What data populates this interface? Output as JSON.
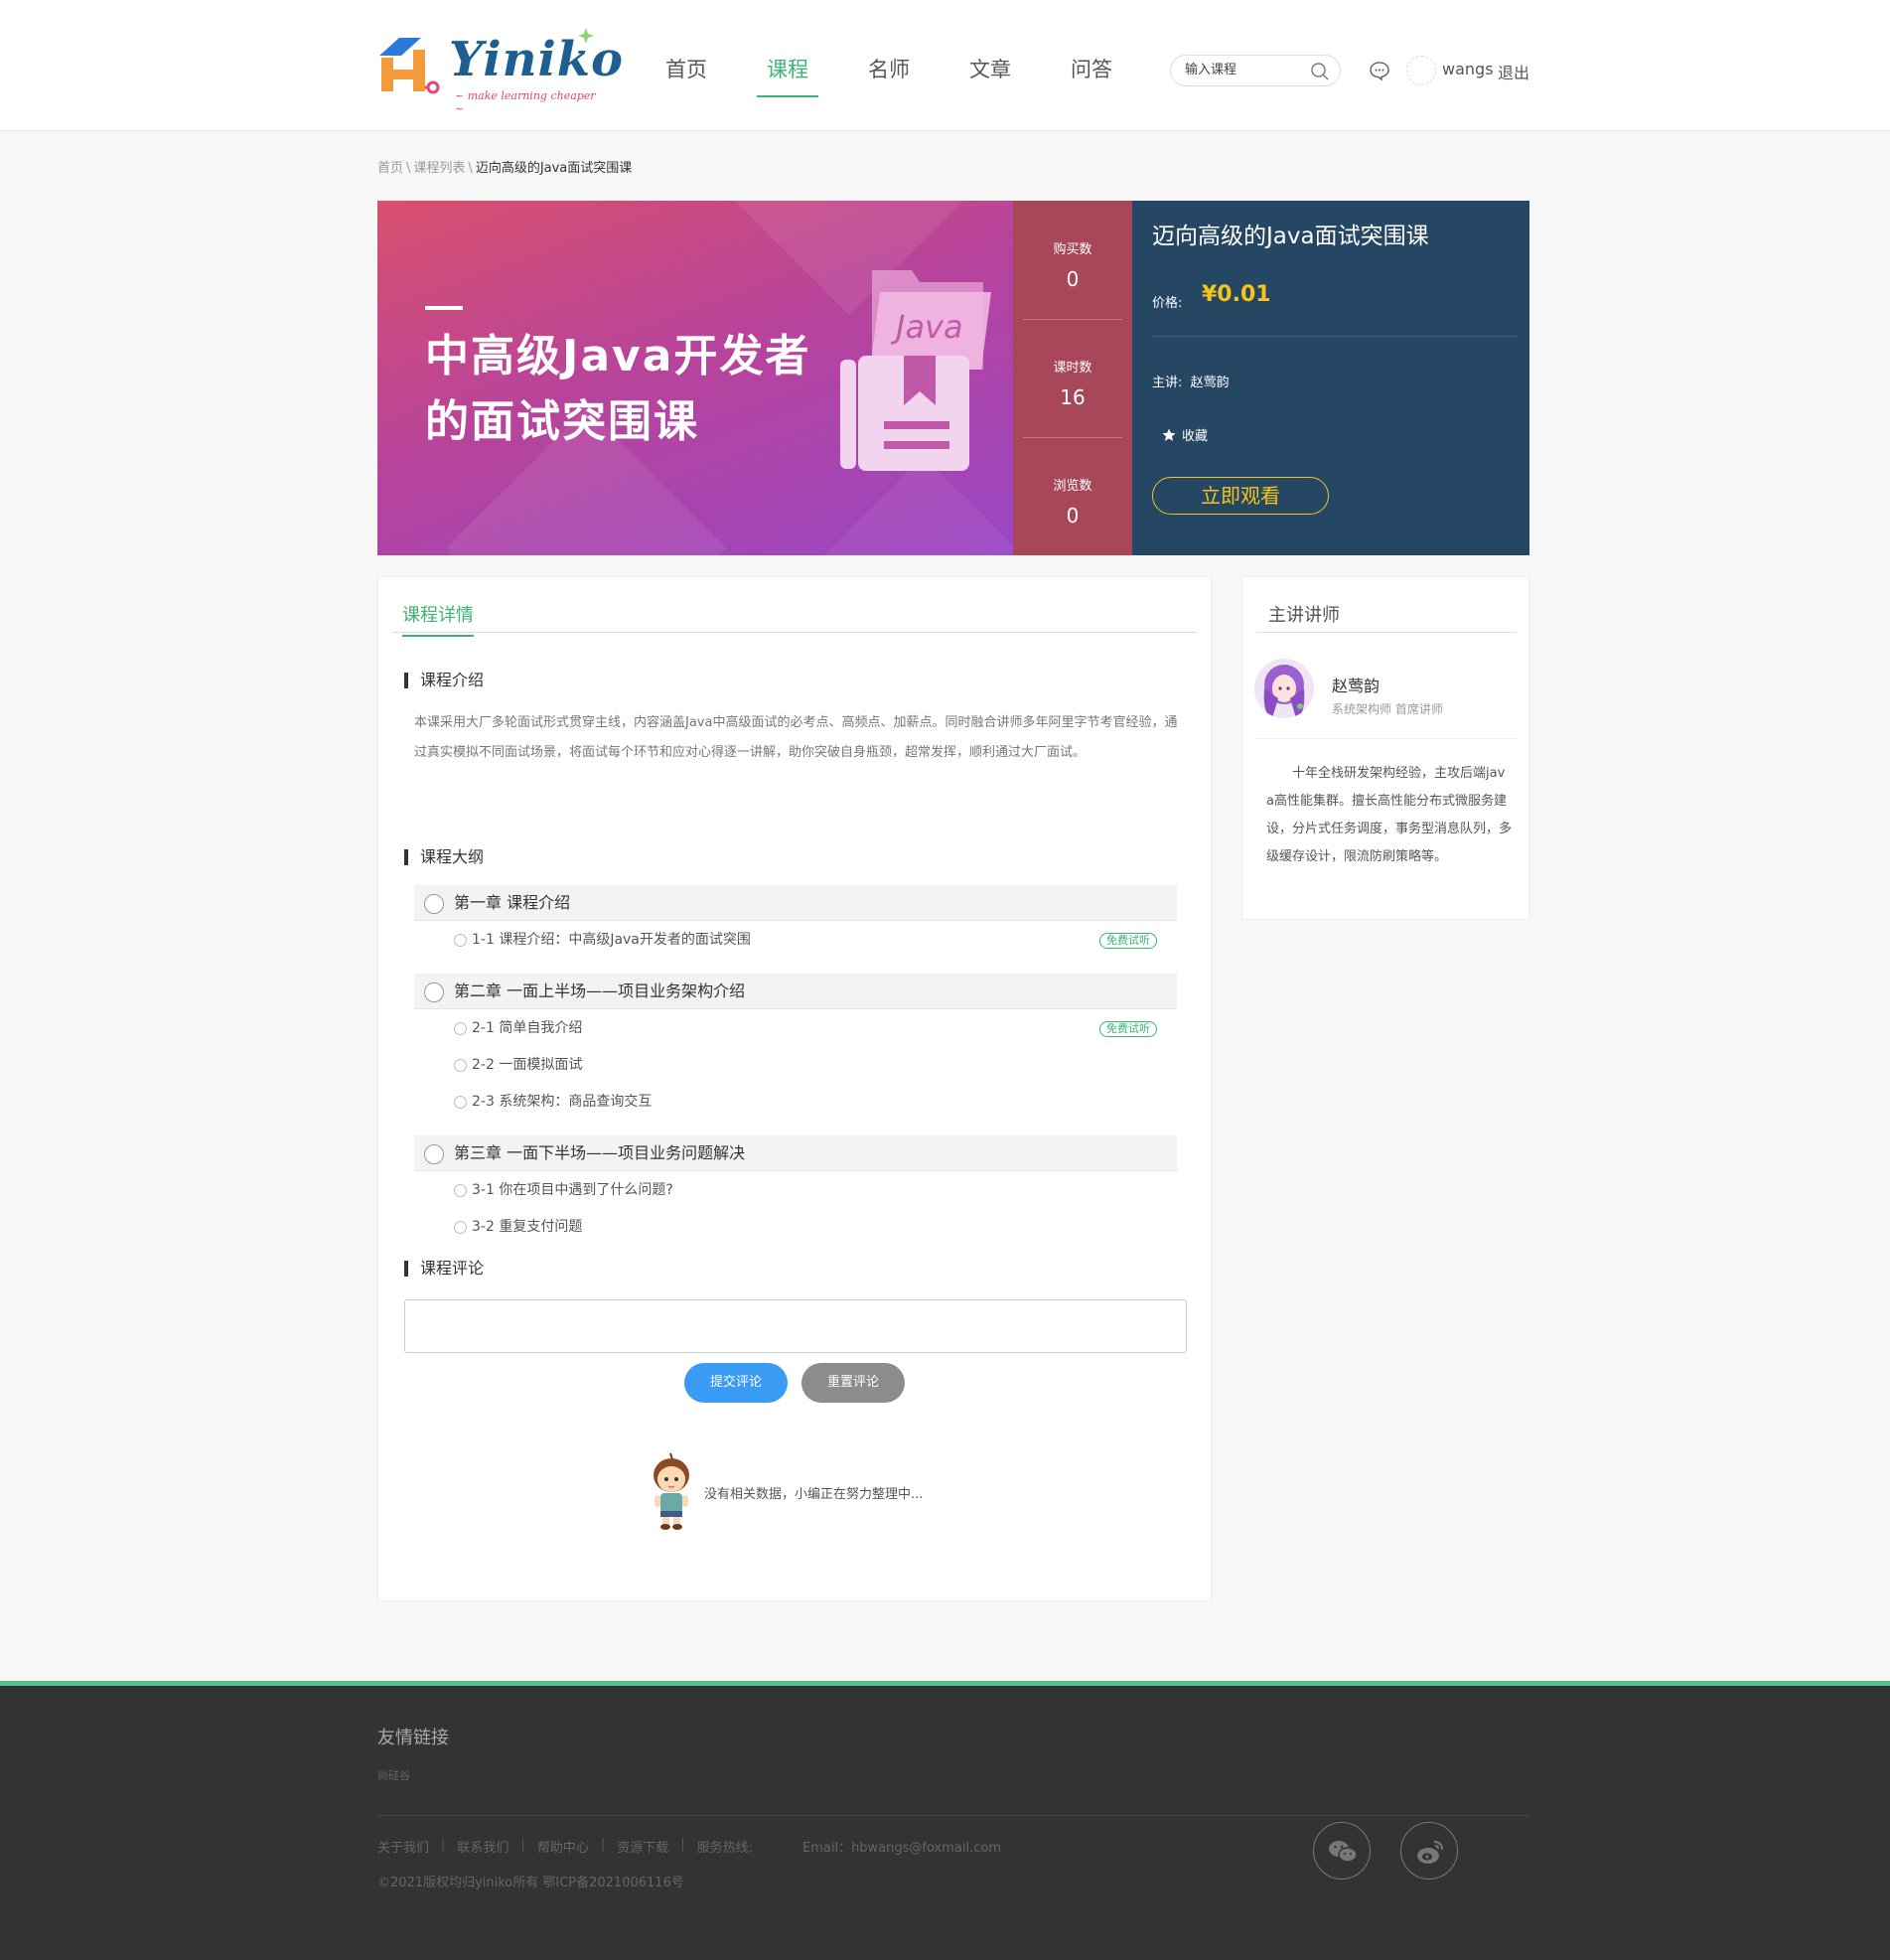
{
  "header": {
    "logo": {
      "text": "Yiniko",
      "slogan": "~ make learning cheaper ~"
    },
    "nav": [
      "首页",
      "课程",
      "名师",
      "文章",
      "问答"
    ],
    "active_nav": "课程",
    "search_placeholder": "输入课程",
    "username": "wangs",
    "logout": "退出",
    "icons": [
      "search-icon",
      "message-icon"
    ]
  },
  "breadcrumb": {
    "home": "首页",
    "sep": "\\",
    "list": "课程列表",
    "current": "迈向高级的Java面试突围课"
  },
  "banner": {
    "cover_line1": "中高级Java开发者",
    "cover_line2": "的面试突围课",
    "cover_tag": "Java",
    "stats": [
      {
        "label": "购买数",
        "value": "0"
      },
      {
        "label": "课时数",
        "value": "16"
      },
      {
        "label": "浏览数",
        "value": "0"
      }
    ],
    "title": "迈向高级的Java面试突围课",
    "price_label": "价格:",
    "price": "¥0.01",
    "teacher_label": "主讲:",
    "teacher": "赵莺韵",
    "favorite": "收藏",
    "watch": "立即观看",
    "colors": {
      "stats_bg": "#a9475a",
      "info_bg": "#264763",
      "accent": "#f5c518"
    }
  },
  "main": {
    "tab": "课程详情",
    "intro_title": "课程介绍",
    "intro": "本课采用大厂多轮面试形式贯穿主线，内容涵盖Java中高级面试的必考点、高频点、加薪点。同时融合讲师多年阿里字节考官经验，通过真实模拟不同面试场景，将面试每个环节和应对心得逐一讲解，助你突破自身瓶颈，超常发挥，顺利通过大厂面试。",
    "outline_title": "课程大纲",
    "chapters": [
      {
        "title": "第一章 课程介绍",
        "lessons": [
          {
            "title": "1-1 课程介绍：中高级Java开发者的面试突围",
            "free": "免费试听"
          }
        ]
      },
      {
        "title": "第二章 一面上半场——项目业务架构介绍",
        "lessons": [
          {
            "title": "2-1 简单自我介绍",
            "free": "免费试听"
          },
          {
            "title": "2-2 一面模拟面试",
            "free": ""
          },
          {
            "title": "2-3 系统架构：商品查询交互",
            "free": ""
          }
        ]
      },
      {
        "title": "第三章 一面下半场——项目业务问题解决",
        "lessons": [
          {
            "title": "3-1 你在项目中遇到了什么问题?",
            "free": ""
          },
          {
            "title": "3-2 重复支付问题",
            "free": ""
          }
        ]
      }
    ],
    "comment_title": "课程评论",
    "submit": "提交评论",
    "reset": "重置评论",
    "empty": "没有相关数据，小编正在努力整理中..."
  },
  "teacher_card": {
    "title": "主讲讲师",
    "name": "赵莺韵",
    "role": "系统架构师  首席讲师",
    "desc": "十年全栈研发架构经验，主攻后端java高性能集群。擅长高性能分布式微服务建设，分片式任务调度，事务型消息队列，多级缓存设计，限流防刷策略等。"
  },
  "footer": {
    "title": "友情链接",
    "link": "尚硅谷",
    "nav": [
      "关于我们",
      "联系我们",
      "帮助中心",
      "资源下载",
      "服务热线:"
    ],
    "email": "Email：hbwangs@foxmail.com",
    "copyright": "©2021版权均归yiniko所有 鄂ICP备2021006116号",
    "icons": [
      "wechat-icon",
      "weibo-icon"
    ]
  }
}
